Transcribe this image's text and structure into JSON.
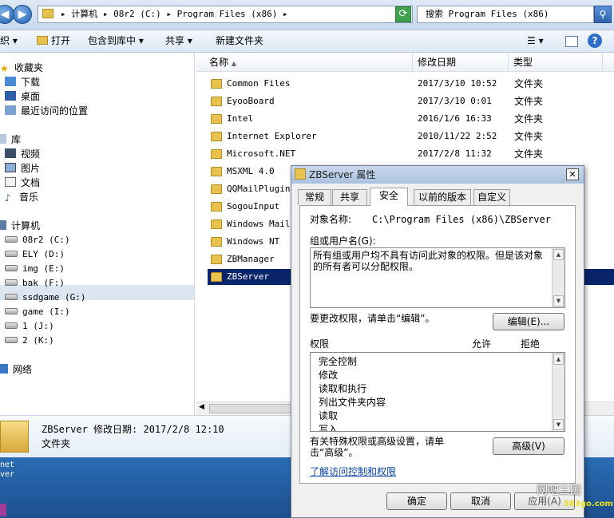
{
  "address_bar": {
    "path": "▸ 计算机 ▸ 08r2 (C:) ▸ Program Files (x86) ▸",
    "search_placeholder": "搜索 Program Files (x86)"
  },
  "toolbar": {
    "organize": "织",
    "open": "打开",
    "include_in_library": "包含到库中",
    "share": "共享",
    "new_folder": "新建文件夹"
  },
  "nav": {
    "favorites": {
      "label": "收藏夹",
      "items": [
        "下载",
        "桌面",
        "最近访问的位置"
      ]
    },
    "libraries": {
      "label": "库",
      "items": [
        "视频",
        "图片",
        "文档",
        "音乐"
      ]
    },
    "computer": {
      "label": "计算机",
      "drives": [
        "08r2 (C:)",
        "ELY (D:)",
        "img (E:)",
        "bak (F:)",
        "ssdgame (G:)",
        "game (I:)",
        "1 (J:)",
        "2 (K:)"
      ]
    },
    "network": {
      "label": "网络"
    }
  },
  "file_list": {
    "columns": {
      "name": "名称",
      "date": "修改日期",
      "type": "类型"
    },
    "rows": [
      {
        "name": "Common Files",
        "date": "2017/3/10 10:52",
        "type": "文件夹"
      },
      {
        "name": "EyooBoard",
        "date": "2017/3/10 0:01",
        "type": "文件夹"
      },
      {
        "name": "Intel",
        "date": "2016/1/6 16:33",
        "type": "文件夹"
      },
      {
        "name": "Internet Explorer",
        "date": "2010/11/22 2:52",
        "type": "文件夹"
      },
      {
        "name": "Microsoft.NET",
        "date": "2017/2/8 11:32",
        "type": "文件夹"
      },
      {
        "name": "MSXML 4.0",
        "date": "",
        "type": ""
      },
      {
        "name": "QQMailPlugin",
        "date": "",
        "type": ""
      },
      {
        "name": "SogouInput",
        "date": "",
        "type": ""
      },
      {
        "name": "Windows Mail",
        "date": "",
        "type": ""
      },
      {
        "name": "Windows NT",
        "date": "",
        "type": ""
      },
      {
        "name": "ZBManager",
        "date": "",
        "type": ""
      },
      {
        "name": "ZBServer",
        "date": "",
        "type": ""
      }
    ]
  },
  "details": {
    "name_line": "ZBServer 修改日期: 2017/2/8 12:10",
    "type": "文件夹"
  },
  "desktop_text": [
    "net",
    "ver"
  ],
  "dialog": {
    "title": "ZBServer 属性",
    "close": "✕",
    "tabs": [
      "常规",
      "共享",
      "安全",
      "以前的版本",
      "自定义"
    ],
    "object_name_label": "对象名称:",
    "object_name_value": "C:\\Program Files (x86)\\ZBServer",
    "group_label": "组或用户名(G):",
    "group_message": "所有组或用户均不具有访问此对象的权限。但是该对象的所有者可以分配权限。",
    "change_hint": "要更改权限，请单击“编辑”。",
    "edit_button": "编辑(E)...",
    "permissions_label": "权限",
    "allow_label": "允许",
    "deny_label": "拒绝",
    "permissions": [
      "完全控制",
      "修改",
      "读取和执行",
      "列出文件夹内容",
      "读取",
      "写入"
    ],
    "advanced_hint": "有关特殊权限或高级设置，请单击“高级”。",
    "advanced_button": "高级(V)",
    "learn_link": "了解访问控制和权限",
    "ok": "确定",
    "cancel": "取消",
    "apply": "应用(A)"
  },
  "watermark": {
    "line1": "网吧三国",
    "line2": "583go.com"
  }
}
